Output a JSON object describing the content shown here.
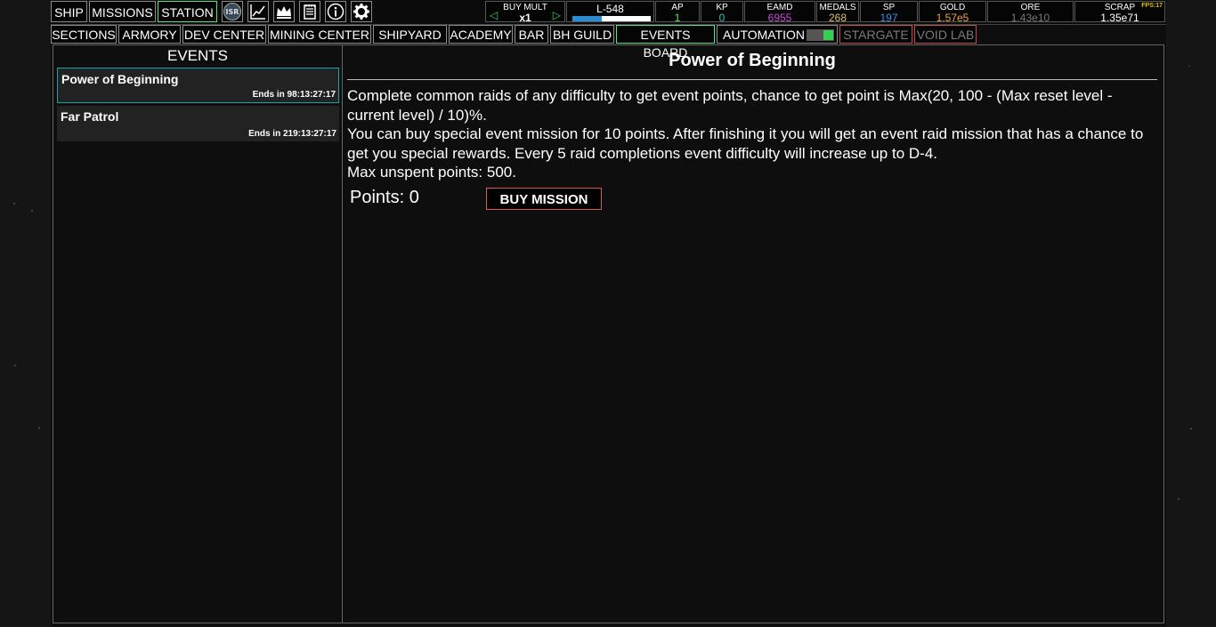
{
  "nav": {
    "ship": "SHIP",
    "missions": "MISSIONS",
    "station": "STATION",
    "isr_icon_text": "ISR"
  },
  "icons": [
    "isr-icon",
    "chart-icon",
    "crown-icon",
    "notes-icon",
    "info-icon",
    "gear-icon"
  ],
  "stats": {
    "buy_mult_label": "BUY MULT",
    "buy_mult_value": "x1",
    "level": "L-548",
    "level_progress": 0.38,
    "ap_label": "AP",
    "ap_value": "1",
    "kp_label": "KP",
    "kp_value": "0",
    "eamd_label": "EAMD",
    "eamd_value": "6955",
    "medals_label": "MEDALS",
    "medals_value": "268",
    "sp_label": "SP",
    "sp_value": "197",
    "gold_label": "GOLD",
    "gold_value": "1.57e5",
    "ore_label": "ORE",
    "ore_value": "1.43e10",
    "scrap_label": "SCRAP",
    "scrap_value": "1.35e71",
    "fps": "FPS:17"
  },
  "colors": {
    "ap": "#5fe05f",
    "kp": "#35c0c8",
    "eamd": "#c94ed8",
    "medals": "#d8c070",
    "sp": "#3a8ee6",
    "gold": "#e8a43a",
    "ore": "#777777",
    "scrap": "#ffffff",
    "active_border": "#5ee08a",
    "locked_border": "#c05050",
    "selected_event": "#1ea0a8"
  },
  "sections": {
    "sections": "SECTIONS",
    "armory": "ARMORY",
    "dev_center": "DEV CENTER",
    "mining_center": "MINING CENTER",
    "shipyard": "SHIPYARD",
    "academy": "ACADEMY",
    "bar": "BAR",
    "bh_guild": "BH GUILD",
    "events_board": "EVENTS BOARD",
    "automation": "AUTOMATION",
    "stargate": "STARGATE",
    "void_lab": "VOID LAB"
  },
  "events_panel": {
    "title": "EVENTS",
    "events": [
      {
        "name": "Power of Beginning",
        "ends": "Ends in 98:13:27:17"
      },
      {
        "name": "Far Patrol",
        "ends": "Ends in 219:13:27:17"
      }
    ]
  },
  "detail": {
    "title": "Power of Beginning",
    "desc1": "Complete common raids of any difficulty to get event points, chance to get point is Max(20, 100 - (Max reset level - current level) / 10)%.",
    "desc2": "You can buy special event mission for 10 points. After finishing it you will get an event raid mission that has a chance to get you special rewards. Every 5 raid completions event difficulty will increase up to D-4.",
    "desc3": "Max unspent points: 500.",
    "points": "Points: 0",
    "buy_button": "BUY MISSION"
  }
}
